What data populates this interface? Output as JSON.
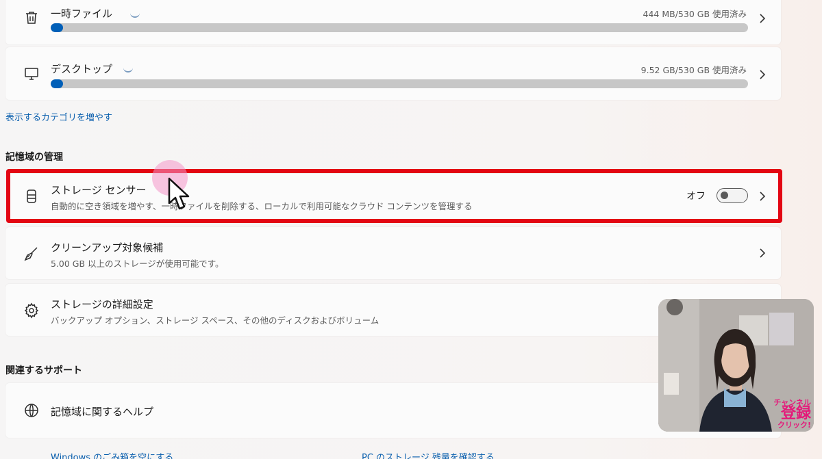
{
  "storage_rows": [
    {
      "title": "一時ファイル",
      "usage": "444 MB/530 GB 使用済み",
      "fraction": 0.0008
    },
    {
      "title": "デスクトップ",
      "usage": "9.52 GB/530 GB 使用済み",
      "fraction": 0.018
    }
  ],
  "show_more_categories": "表示するカテゴリを増やす",
  "management": {
    "heading": "記憶域の管理",
    "storage_sense": {
      "title": "ストレージ センサー",
      "subtitle": "自動的に空き領域を増やす、一時ファイルを削除する、ローカルで利用可能なクラウド コンテンツを管理する",
      "toggle_label": "オフ",
      "toggle_on": false
    },
    "cleanup": {
      "title": "クリーンアップ対象候補",
      "subtitle": "5.00 GB 以上のストレージが使用可能です。"
    },
    "advanced": {
      "title": "ストレージの詳細設定",
      "subtitle": "バックアップ オプション、ストレージ スペース、その他のディスクおよびボリューム"
    }
  },
  "support": {
    "heading": "関連するサポート",
    "help_title": "記憶域に関するヘルプ",
    "links": [
      "Windows のごみ箱を空にする",
      "PC のストレージ 残量を確認する"
    ]
  },
  "webcam_overlay": {
    "label_line1": "チャンネル",
    "label_line2": "登録",
    "label_line3": "クリック!"
  },
  "colors": {
    "accent": "#005fb8",
    "highlight": "#e30613",
    "overlay_text": "#e4197a"
  }
}
